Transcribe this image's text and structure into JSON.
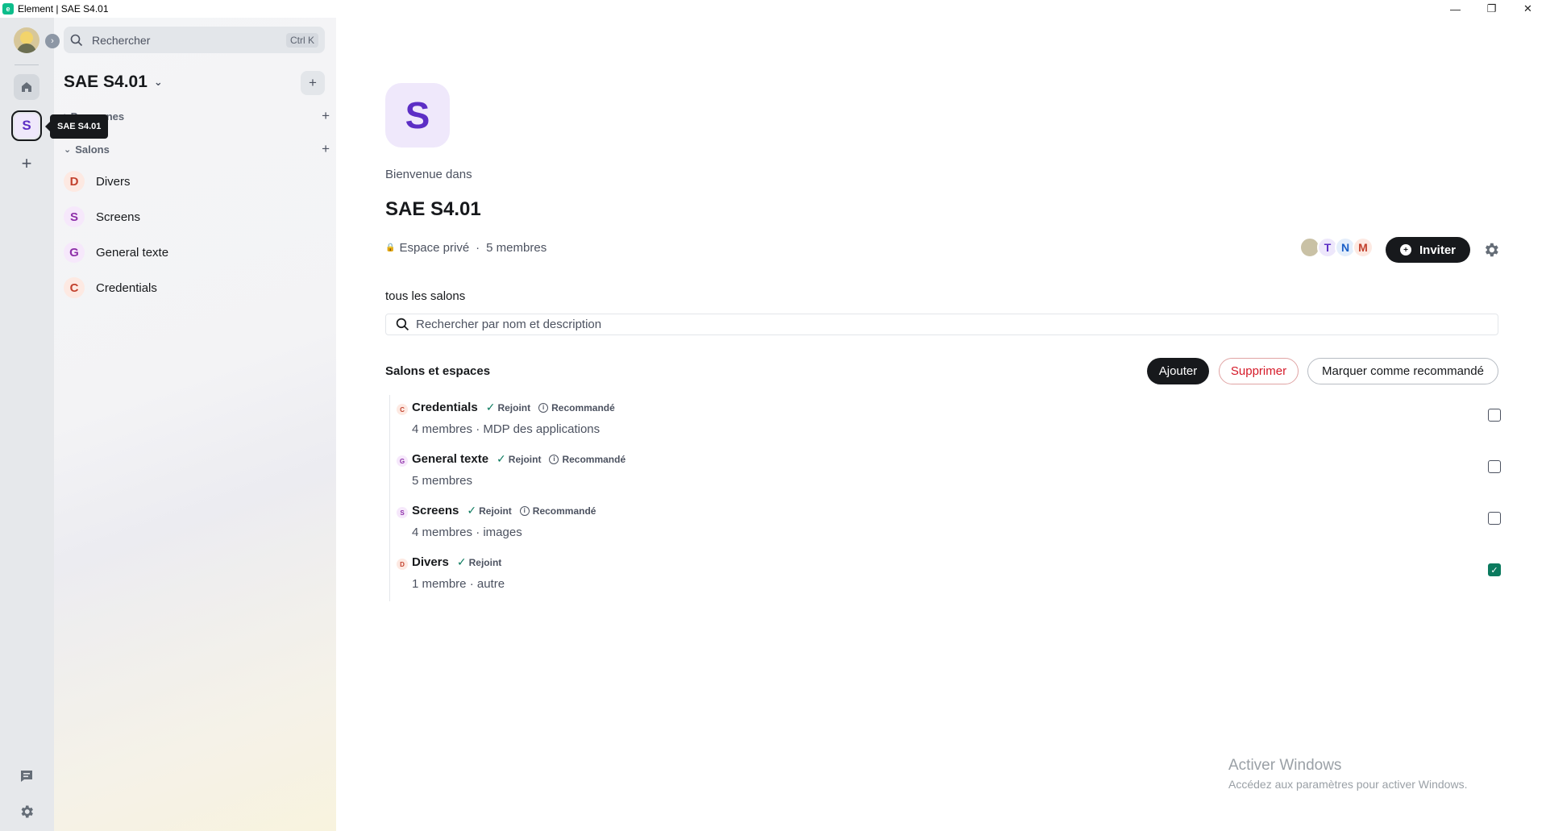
{
  "window": {
    "title": "Element | SAE S4.01",
    "controls": [
      "—",
      "❐",
      "✕"
    ]
  },
  "rail": {
    "space_letter": "S",
    "tooltip": "SAE S4.01"
  },
  "roomlist": {
    "search_placeholder": "Rechercher",
    "search_shortcut": "Ctrl K",
    "space_name": "SAE S4.01",
    "people_section": "Personnes",
    "rooms_section": "Salons",
    "rooms": [
      {
        "letter": "D",
        "name": "Divers",
        "color": "#c2412d",
        "bg": "#fde9e2"
      },
      {
        "letter": "S",
        "name": "Screens",
        "color": "#8d2fa8",
        "bg": "#f6e8fb"
      },
      {
        "letter": "G",
        "name": "General texte",
        "color": "#8d2fa8",
        "bg": "#f6e8fb"
      },
      {
        "letter": "C",
        "name": "Credentials",
        "color": "#c2412d",
        "bg": "#fde9e2"
      }
    ]
  },
  "main": {
    "avatar_letter": "S",
    "welcome": "Bienvenue dans",
    "title": "SAE S4.01",
    "privacy": "Espace privé",
    "members_count": "5 membres",
    "member_avatars": [
      {
        "letter": "T",
        "color": "#5c2ec5",
        "bg": "#ede7fb"
      },
      {
        "letter": "N",
        "color": "#1a5fc7",
        "bg": "#e4eefb"
      },
      {
        "letter": "M",
        "color": "#c2412d",
        "bg": "#fde9e2"
      }
    ],
    "invite_label": "Inviter",
    "description": "tous les salons",
    "search_placeholder": "Rechercher par nom et description",
    "section_title": "Salons et espaces",
    "btn_add": "Ajouter",
    "btn_delete": "Supprimer",
    "btn_recommend": "Marquer comme recommandé",
    "rows": [
      {
        "letter": "C",
        "name": "Credentials",
        "joined": "Rejoint",
        "recommended": "Recommandé",
        "sub": "4 membres · MDP des applications",
        "checked": false,
        "color": "#c2412d",
        "bg": "#fde9e2"
      },
      {
        "letter": "G",
        "name": "General texte",
        "joined": "Rejoint",
        "recommended": "Recommandé",
        "sub": "5 membres",
        "checked": false,
        "color": "#8d2fa8",
        "bg": "#f6e8fb"
      },
      {
        "letter": "S",
        "name": "Screens",
        "joined": "Rejoint",
        "recommended": "Recommandé",
        "sub": "4 membres · images",
        "checked": false,
        "color": "#8d2fa8",
        "bg": "#f6e8fb"
      },
      {
        "letter": "D",
        "name": "Divers",
        "joined": "Rejoint",
        "recommended": "",
        "sub": "1 membre · autre",
        "checked": true,
        "color": "#c2412d",
        "bg": "#fde9e2"
      }
    ]
  },
  "watermark": {
    "line1": "Activer Windows",
    "line2": "Accédez aux paramètres pour activer Windows."
  }
}
